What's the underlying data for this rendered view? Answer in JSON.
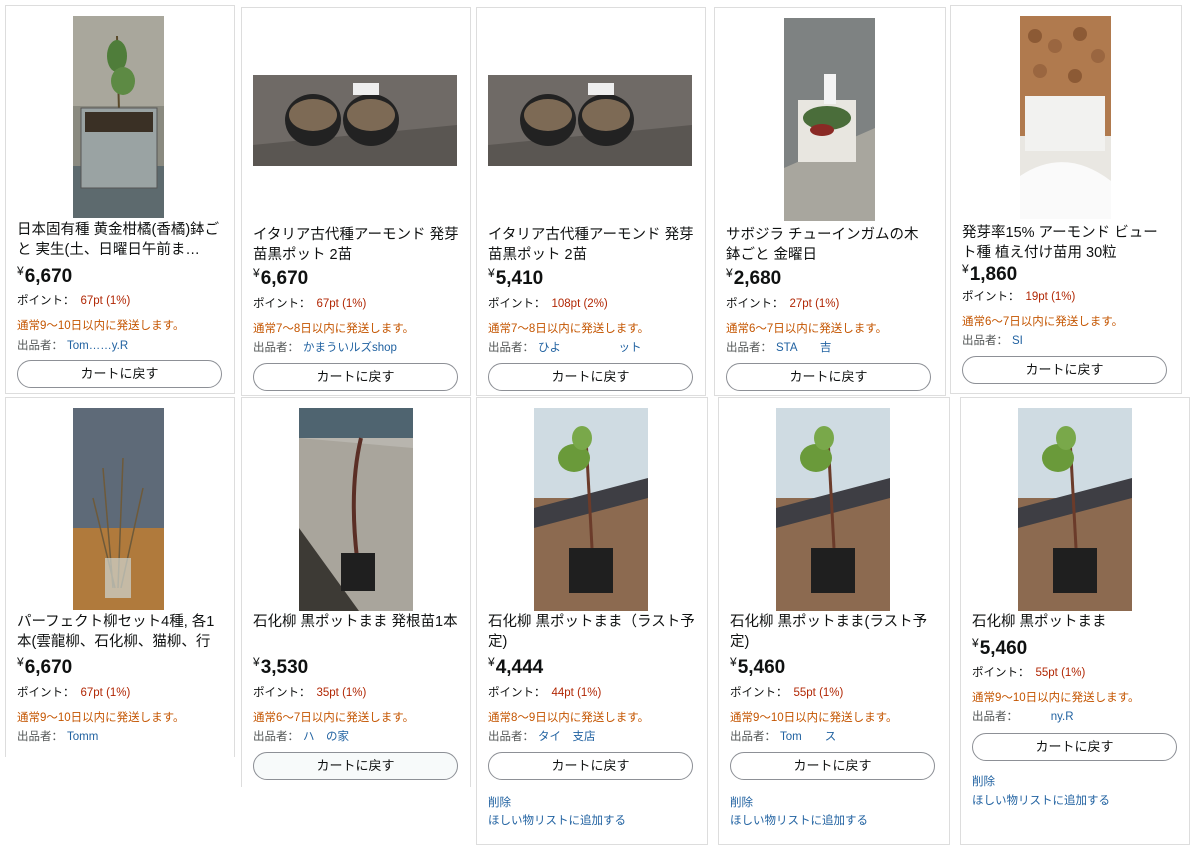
{
  "products": [
    {
      "title": "日本固有種 黄金柑橘(香橘)鉢ごと 実生(土、日曜日午前ま…",
      "price": "6,670",
      "points": "67pt (1%)",
      "shipping": "通常9～10日以内に発送します。",
      "seller": "Tom……y.R",
      "button": "カートに戻す"
    },
    {
      "title": "イタリア古代種アーモンド 発芽苗黒ポット 2苗",
      "price": "6,670",
      "points": "67pt (1%)",
      "shipping": "通常7～8日以内に発送します。",
      "seller": "かまういルズshop",
      "button": "カートに戻す"
    },
    {
      "title": "イタリア古代種アーモンド 発芽苗黒ポット 2苗",
      "price": "5,410",
      "points": "108pt (2%)",
      "shipping": "通常7～8日以内に発送します。",
      "seller": "ひよ　　　　　ット",
      "button": "カートに戻す"
    },
    {
      "title": "サボジラ チューインガムの木 鉢ごと 金曜日",
      "price": "2,680",
      "points": "27pt (1%)",
      "shipping": "通常6～7日以内に発送します。",
      "seller": "STA　　吉",
      "button": "カートに戻す"
    },
    {
      "title": "発芽率15% アーモンド ビュート種 植え付け苗用 30粒",
      "price": "1,860",
      "points": "19pt (1%)",
      "shipping": "通常6～7日以内に発送します。",
      "seller": "SI",
      "button": "カートに戻す"
    },
    {
      "title": "パーフェクト柳セット4種, 各1本(雲龍柳、石化柳、猫柳、行",
      "price": "6,670",
      "points": "67pt (1%)",
      "shipping": "通常9～10日以内に発送します。",
      "seller": "Tomm"
    },
    {
      "title": "石化柳 黒ポットまま 発根苗1本",
      "price": "3,530",
      "points": "35pt (1%)",
      "shipping": "通常6～7日以内に発送します。",
      "seller": "ハ　の家",
      "button": "カートに戻す"
    },
    {
      "title": "石化柳 黒ポットまま（ラスト予定)",
      "price": "4,444",
      "points": "44pt (1%)",
      "shipping": "通常8～9日以内に発送します。",
      "seller": "タイ　支店",
      "button": "カートに戻す",
      "delete": "削除",
      "wishlist": "ほしい物リストに追加する"
    },
    {
      "title": "石化柳 黒ポットまま(ラスト予定)",
      "price": "5,460",
      "points": "55pt (1%)",
      "shipping": "通常9～10日以内に発送します。",
      "seller": "Tom　　ス",
      "button": "カートに戻す",
      "delete": "削除",
      "wishlist": "ほしい物リストに追加する"
    },
    {
      "title": "石化柳 黒ポットまま",
      "price": "5,460",
      "points": "55pt (1%)",
      "shipping": "通常9～10日以内に発送します。",
      "seller": "　　　ny.R",
      "button": "カートに戻す",
      "delete": "削除",
      "wishlist": "ほしい物リストに追加する"
    }
  ],
  "labels": {
    "points_label": "ポイント：",
    "seller_label": "出品者：",
    "yen": "¥"
  },
  "colors": {
    "price_points": "#b12704",
    "shipping": "#c45500",
    "link": "#2162a1",
    "border": "#dddddd"
  }
}
